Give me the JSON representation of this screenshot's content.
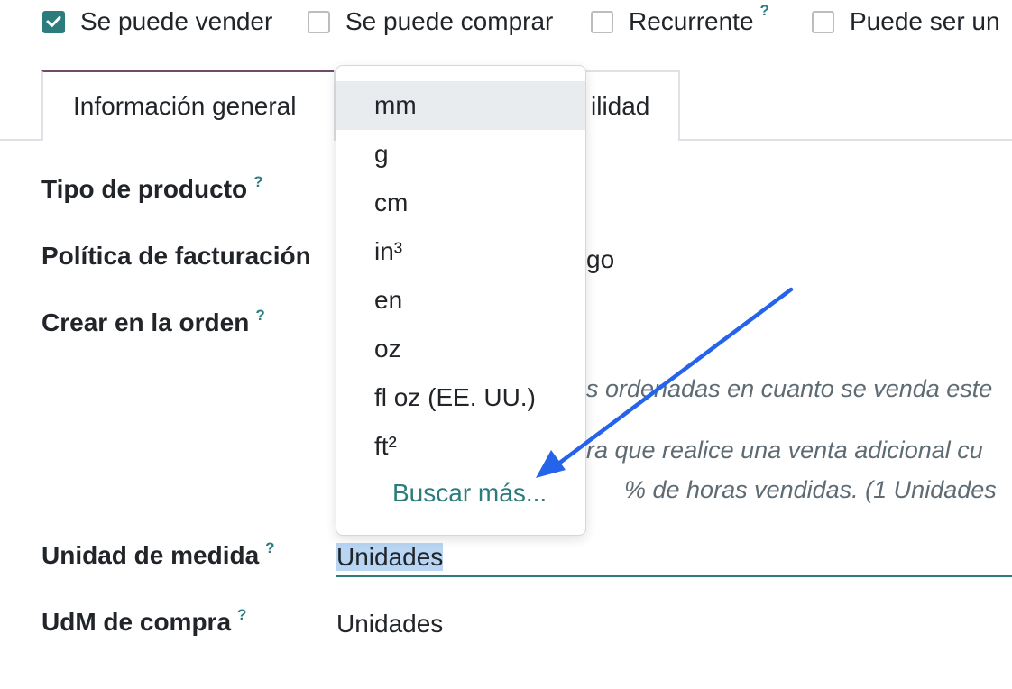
{
  "checkboxes": [
    {
      "label": "Se puede vender",
      "checked": true
    },
    {
      "label": "Se puede comprar",
      "checked": false
    },
    {
      "label": "Recurrente",
      "checked": false,
      "help": "?"
    },
    {
      "label": "Puede ser un",
      "checked": false
    }
  ],
  "tabs": {
    "general": "Información general",
    "partial_visible": "ilidad"
  },
  "form": {
    "product_type_label": "Tipo de producto",
    "invoice_policy_label": "Política de facturación",
    "invoice_policy_partial": "go",
    "create_on_order_label": "Crear en la orden",
    "hint_line1": "s ordenadas en cuanto se venda este",
    "hint_line2": "ra que realice una venta adicional cu",
    "hint_line3": "% de horas vendidas. (1 Unidades",
    "uom_label": "Unidad de medida",
    "uom_value": "Unidades",
    "purchase_uom_label": "UdM de compra",
    "purchase_uom_value": "Unidades",
    "help_mark": "?"
  },
  "dropdown": {
    "items": [
      "mm",
      "g",
      "cm",
      "in³",
      "en",
      "oz",
      "fl oz (EE. UU.)",
      "ft²"
    ],
    "highlighted_index": 0,
    "search_more": "Buscar más..."
  },
  "colors": {
    "primary_teal": "#2c7c7d",
    "tab_accent": "#714b67",
    "annotation_arrow": "#2563eb",
    "selection": "#b9d5f4"
  }
}
